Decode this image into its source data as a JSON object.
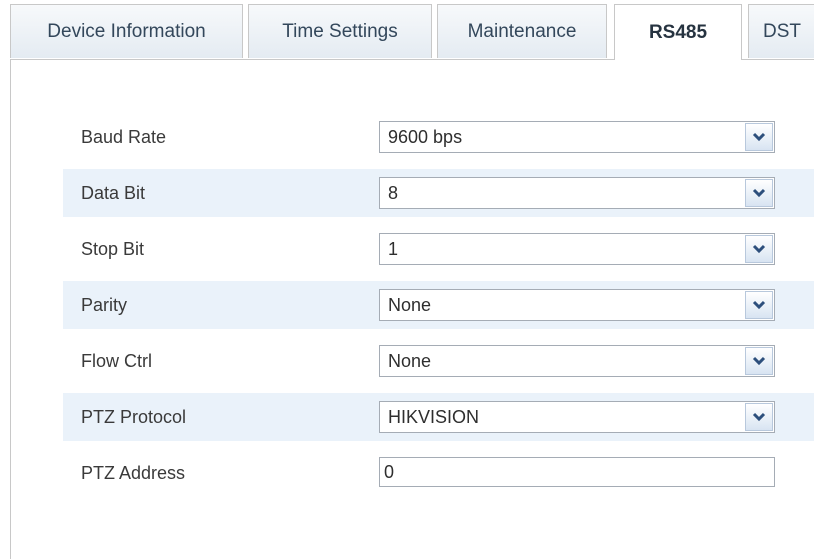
{
  "tabs": [
    {
      "label": "Device Information",
      "active": false
    },
    {
      "label": "Time Settings",
      "active": false
    },
    {
      "label": "Maintenance",
      "active": false
    },
    {
      "label": "RS485",
      "active": true
    },
    {
      "label": "DST",
      "active": false
    }
  ],
  "form": {
    "baud_rate": {
      "label": "Baud Rate",
      "value": "9600 bps"
    },
    "data_bit": {
      "label": "Data Bit",
      "value": "8"
    },
    "stop_bit": {
      "label": "Stop Bit",
      "value": "1"
    },
    "parity": {
      "label": "Parity",
      "value": "None"
    },
    "flow_ctrl": {
      "label": "Flow Ctrl",
      "value": "None"
    },
    "ptz_protocol": {
      "label": "PTZ Protocol",
      "value": "HIKVISION"
    },
    "ptz_address": {
      "label": "PTZ Address",
      "value": "0"
    }
  },
  "icons": {
    "dropdown": "chevron-down-icon"
  },
  "colors": {
    "row_shade": "#eaf2fa",
    "chevron": "#2d4f7c",
    "border": "#c8c8c8"
  }
}
